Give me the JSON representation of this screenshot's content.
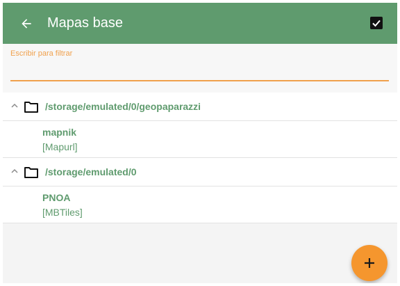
{
  "appbar": {
    "title": "Mapas base",
    "back_icon": "arrow-left-icon",
    "select_all_icon": "checkbox-checked-icon",
    "color": "#5f9b6e"
  },
  "filter": {
    "label": "Escribir para filtrar",
    "value": "",
    "accent_color": "#f0a04c"
  },
  "groups": [
    {
      "path": "/storage/emulated/0/geopaparazzi",
      "expanded": true,
      "items": [
        {
          "name": "mapnik",
          "type": "[Mapurl]"
        }
      ]
    },
    {
      "path": "/storage/emulated/0",
      "expanded": true,
      "items": [
        {
          "name": "PNOA",
          "type": "[MBTiles]"
        }
      ]
    }
  ],
  "fab": {
    "icon": "plus-icon",
    "color": "#f5962e"
  }
}
